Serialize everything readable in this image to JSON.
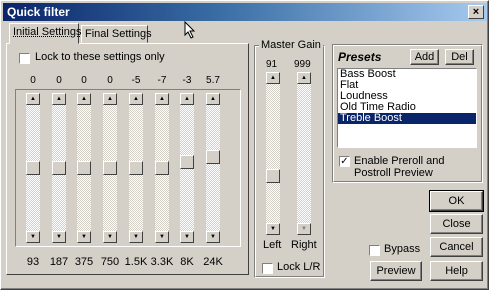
{
  "window": {
    "title": "Quick filter",
    "close_glyph": "×"
  },
  "tabs": [
    {
      "label": "Initial Settings",
      "active": true
    },
    {
      "label": "Final Settings",
      "active": false
    }
  ],
  "lock": {
    "label": "Lock to these settings only",
    "checked": false
  },
  "eq": {
    "values": [
      "0",
      "0",
      "0",
      "0",
      "-5",
      "-7",
      "-3",
      "5.7"
    ],
    "frequencies": [
      "93",
      "187",
      "375",
      "750",
      "1.5K",
      "3.3K",
      "8K",
      "24K"
    ],
    "levels": [
      0.5,
      0.5,
      0.5,
      0.5,
      0.5,
      0.5,
      0.55,
      0.6
    ]
  },
  "master_gain": {
    "title": "Master Gain",
    "left_value": "91",
    "right_value": "999",
    "left_label": "Left",
    "right_label": "Right",
    "lock_lr_label": "Lock L/R",
    "lock_lr_checked": false
  },
  "presets": {
    "title": "Presets",
    "add_label": "Add",
    "del_label": "Del",
    "items": [
      "Bass Boost",
      "Flat",
      "Loudness",
      "Old Time Radio",
      "Treble Boost"
    ],
    "selected_index": 4,
    "enable_label": "Enable Preroll and Postroll Preview",
    "enable_checked": true
  },
  "buttons": {
    "ok": "OK",
    "close": "Close",
    "cancel": "Cancel",
    "help": "Help",
    "preview": "Preview"
  },
  "bypass": {
    "label": "Bypass",
    "checked": false
  }
}
